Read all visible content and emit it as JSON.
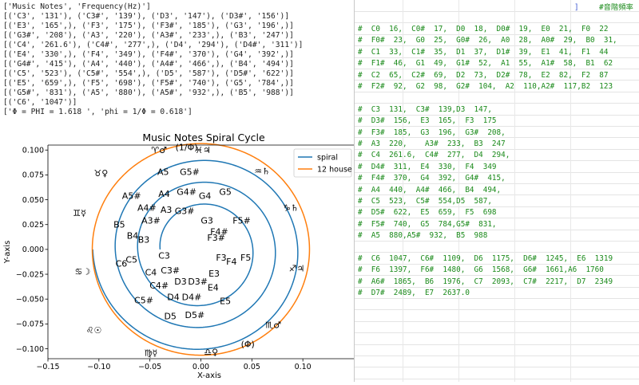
{
  "output": {
    "lines": [
      "['Music Notes', 'Frequency(Hz)']",
      "[('C3', '131'), ('C3#', '139'), ('D3', '147'), ('D3#', '156')]",
      "[('E3', '165',), ('F3', '175'), ('F3#', '185'), ('G3', '196',)]",
      "[('G3#', '208'), ('A3', '220'), ('A3#', '233',), ('B3', '247')]",
      "[('C4', '261.6'), ('C4#', '277',), ('D4', '294'), ('D4#', '311')]",
      "[('E4', '330',), ('F4', '349'), ('F4#', '370'), ('G4', '392',)]",
      "[('G4#', '415'), ('A4', '440'), ('A4#', '466',), ('B4', '494')]",
      "[('C5', '523'), ('C5#', '554',), ('D5', '587'), ('D5#', '622')]",
      "[('E5', '659',), ('F5', '698'), ('F5#', '740'), ('G5', '784',)]",
      "[('G5#', '831'), ('A5', '880'), ('A5#', '932',), ('B5', '988')]",
      "[('C6', '1047')]",
      "['Φ = PHI = 1.618 ', 'phi = 1/Φ = 0.618']"
    ]
  },
  "sheet": {
    "header_bracket": "]",
    "header_comment": "#音階頻率",
    "lines": [
      "#  C0  16,  C0#  17,  D0  18,  D0#  19,  E0  21,  F0  22",
      "#  F0#  23,  G0  25,  G0#  26,  A0  28,  A0#  29,  B0  31,",
      "#  C1  33,  C1#  35,  D1  37,  D1#  39,  E1  41,  F1  44",
      "#  F1#  46,  G1  49,  G1#  52,  A1  55,  A1#  58,  B1  62",
      "#  C2  65,  C2#  69,  D2  73,  D2#  78,  E2  82,  F2  87",
      "#  F2#  92,  G2  98,  G2#  104,  A2  110,A2#  117,B2  123",
      "",
      "#  C3  131,  C3#  139,D3  147,",
      "#  D3#  156,  E3  165,  F3  175",
      "#  F3#  185,  G3  196,  G3#  208,",
      "#  A3  220,    A3#  233,  B3  247",
      "#  C4  261.6,  C4#  277,  D4  294,",
      "#  D4#  311,  E4  330,  F4  349",
      "#  F4#  370,  G4  392,  G4#  415,",
      "#  A4  440,  A4#  466,  B4  494,",
      "#  C5  523,  C5#  554,D5  587,",
      "#  D5#  622,  E5  659,  F5  698",
      "#  F5#  740,  G5  784,G5#  831,",
      "#  A5  880,A5#  932,  B5  988",
      "",
      "#  C6  1047,  C6#  1109,  D6  1175,  D6#  1245,  E6  1319",
      "#  F6  1397,  F6#  1480,  G6  1568,  G6#  1661,A6  1760",
      "#  A6#  1865,  B6  1976,  C7  2093,  C7#  2217,  D7  2349",
      "#  D7#  2489,  E7  2637.0"
    ]
  },
  "chart_data": {
    "type": "line",
    "title": "Music Notes Spiral Cycle",
    "xlabel": "X-axis",
    "ylabel": "Y-axis",
    "xlim": [
      -0.15,
      0.15
    ],
    "ylim": [
      -0.11,
      0.105
    ],
    "xticks": [
      "−0.15",
      "−0.10",
      "−0.05",
      "0.00",
      "0.05",
      "0.10"
    ],
    "yticks": [
      "0.100",
      "0.075",
      "0.050",
      "0.025",
      "0.000",
      "−0.025",
      "−0.050",
      "−0.075",
      "−0.100"
    ],
    "xtick_values": [
      -0.15,
      -0.1,
      -0.05,
      0.0,
      0.05,
      0.1
    ],
    "ytick_values": [
      0.1,
      0.075,
      0.05,
      0.025,
      0.0,
      -0.025,
      -0.05,
      -0.075,
      -0.1
    ],
    "legend_position": "top-right",
    "series": [
      {
        "name": "spiral",
        "color": "#1f77b4",
        "r_start": 0.04,
        "r_end": 0.106,
        "turns": 3
      },
      {
        "name": "12 house",
        "color": "#ff7f0e",
        "radius": 0.1065
      }
    ],
    "note_labels": [
      {
        "text": "C3",
        "x": -0.036,
        "y": -0.006
      },
      {
        "text": "C3#",
        "x": -0.03,
        "y": -0.021
      },
      {
        "text": "D3",
        "x": -0.02,
        "y": -0.032
      },
      {
        "text": "D3#",
        "x": -0.003,
        "y": -0.032
      },
      {
        "text": "E3",
        "x": 0.013,
        "y": -0.024
      },
      {
        "text": "F3",
        "x": 0.02,
        "y": -0.008
      },
      {
        "text": "F3#",
        "x": 0.015,
        "y": 0.012
      },
      {
        "text": "G3",
        "x": 0.006,
        "y": 0.029
      },
      {
        "text": "G3#",
        "x": -0.016,
        "y": 0.039
      },
      {
        "text": "A3",
        "x": -0.034,
        "y": 0.04
      },
      {
        "text": "A3#",
        "x": -0.049,
        "y": 0.029
      },
      {
        "text": "B3",
        "x": -0.056,
        "y": 0.01
      },
      {
        "text": "C4",
        "x": -0.049,
        "y": -0.023
      },
      {
        "text": "C4#",
        "x": -0.041,
        "y": -0.036
      },
      {
        "text": "D4",
        "x": -0.027,
        "y": -0.048
      },
      {
        "text": "D4#",
        "x": -0.009,
        "y": -0.048
      },
      {
        "text": "E4",
        "x": 0.012,
        "y": -0.038
      },
      {
        "text": "F4",
        "x": 0.03,
        "y": -0.012
      },
      {
        "text": "F4#",
        "x": 0.018,
        "y": 0.018
      },
      {
        "text": "G4",
        "x": 0.004,
        "y": 0.054
      },
      {
        "text": "G4#",
        "x": -0.014,
        "y": 0.058
      },
      {
        "text": "A4",
        "x": -0.036,
        "y": 0.056
      },
      {
        "text": "A4#",
        "x": -0.053,
        "y": 0.042
      },
      {
        "text": "B4",
        "x": -0.067,
        "y": 0.014
      },
      {
        "text": "C5",
        "x": -0.068,
        "y": -0.01
      },
      {
        "text": "C5#",
        "x": -0.056,
        "y": -0.051
      },
      {
        "text": "D5",
        "x": -0.03,
        "y": -0.067
      },
      {
        "text": "D5#",
        "x": -0.006,
        "y": -0.066
      },
      {
        "text": "E5",
        "x": 0.024,
        "y": -0.052
      },
      {
        "text": "F5",
        "x": 0.044,
        "y": -0.008
      },
      {
        "text": "F5#",
        "x": 0.04,
        "y": 0.029
      },
      {
        "text": "G5",
        "x": 0.024,
        "y": 0.058
      },
      {
        "text": "G5#",
        "x": -0.011,
        "y": 0.078
      },
      {
        "text": "A5",
        "x": -0.037,
        "y": 0.078
      },
      {
        "text": "A5#",
        "x": -0.068,
        "y": 0.054
      },
      {
        "text": "B5",
        "x": -0.08,
        "y": 0.025
      },
      {
        "text": "C6",
        "x": -0.078,
        "y": -0.014
      }
    ],
    "zodiac_labels": [
      {
        "text": "♈♂",
        "x": -0.041,
        "y": 0.1
      },
      {
        "text": "(1/Φ)",
        "x": -0.014,
        "y": 0.103
      },
      {
        "text": "♓♃",
        "x": 0.002,
        "y": 0.1
      },
      {
        "text": "♒♄",
        "x": 0.06,
        "y": 0.079
      },
      {
        "text": "♑♄",
        "x": 0.088,
        "y": 0.042
      },
      {
        "text": "♐♃",
        "x": 0.094,
        "y": -0.019
      },
      {
        "text": "♏♂",
        "x": 0.071,
        "y": -0.076
      },
      {
        "text": "(Φ)",
        "x": 0.046,
        "y": -0.095
      },
      {
        "text": "♎♀",
        "x": 0.01,
        "y": -0.103
      },
      {
        "text": "♍☿",
        "x": -0.049,
        "y": -0.104
      },
      {
        "text": "♌☉",
        "x": -0.105,
        "y": -0.081
      },
      {
        "text": "♋☽",
        "x": -0.116,
        "y": -0.022
      },
      {
        "text": "♊☿",
        "x": -0.119,
        "y": 0.037
      },
      {
        "text": "♉♀",
        "x": -0.098,
        "y": 0.077
      }
    ]
  }
}
